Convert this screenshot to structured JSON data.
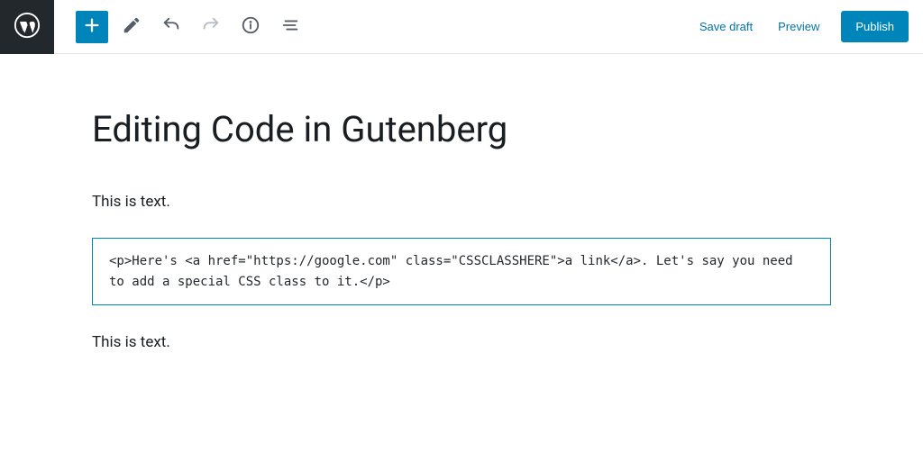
{
  "header": {
    "save_draft_label": "Save draft",
    "preview_label": "Preview",
    "publish_label": "Publish"
  },
  "icons": {
    "wp_logo": "wordpress-icon",
    "add": "plus-icon",
    "edit": "pencil-icon",
    "undo": "undo-icon",
    "redo": "redo-icon",
    "info": "info-icon",
    "outline": "outline-icon"
  },
  "colors": {
    "primary": "#0085ba",
    "dark": "#23282d",
    "link": "#0073aa"
  },
  "post": {
    "title": "Editing Code in Gutenberg",
    "blocks": [
      {
        "type": "paragraph",
        "text": "This is text."
      },
      {
        "type": "html",
        "text": "<p>Here's <a href=\"https://google.com\" class=\"CSSCLASSHERE\">a link</a>. Let's say you need to add a special CSS class to it.</p>"
      },
      {
        "type": "paragraph",
        "text": "This is text."
      }
    ]
  }
}
